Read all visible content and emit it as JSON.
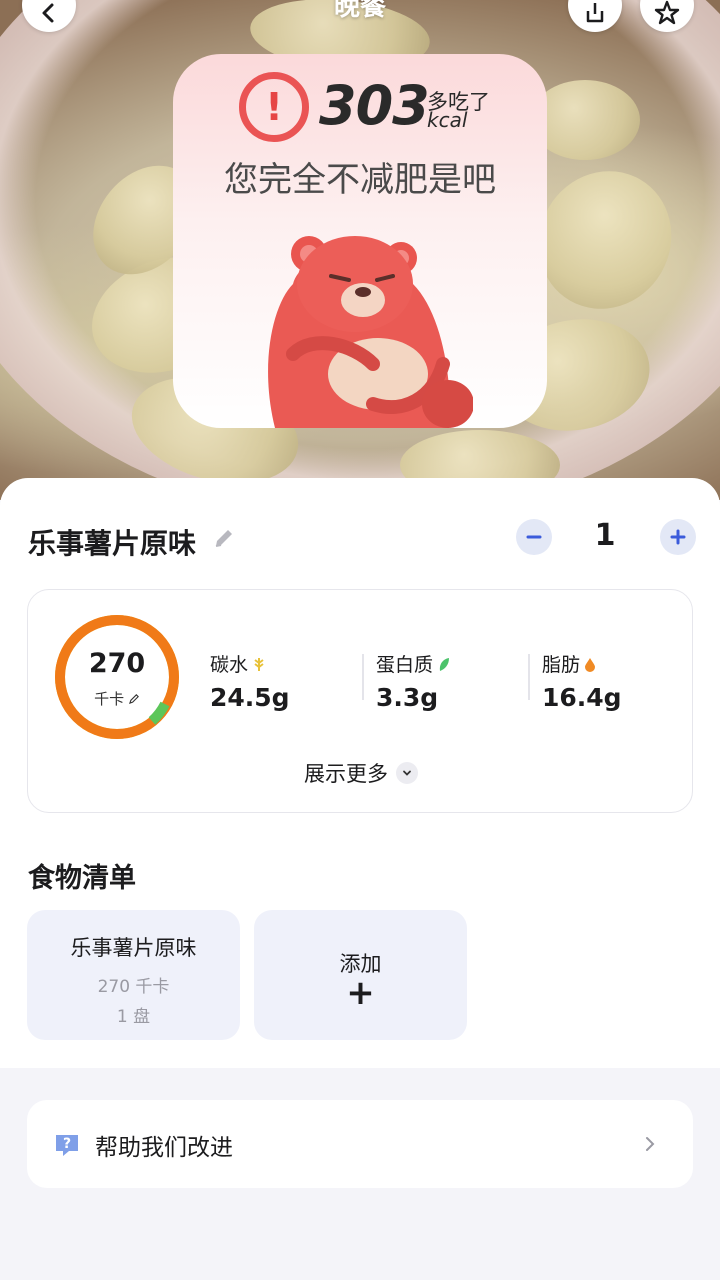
{
  "header": {
    "meal_title": "晚餐"
  },
  "warning": {
    "calories_over": "303",
    "over_label": "多吃了",
    "unit": "kcal",
    "message": "您完全不减肥是吧"
  },
  "food": {
    "name": "乐事薯片原味",
    "quantity": "1"
  },
  "nutrition": {
    "calories": "270",
    "calories_unit": "千卡",
    "macros": [
      {
        "label": "碳水",
        "value": "24.5g",
        "icon": "wheat-icon",
        "color": "#e8c23a"
      },
      {
        "label": "蛋白质",
        "value": "3.3g",
        "icon": "leaf-icon",
        "color": "#4cc36b"
      },
      {
        "label": "脂肪",
        "value": "16.4g",
        "icon": "drop-icon",
        "color": "#f08a24"
      }
    ],
    "show_more": "展示更多"
  },
  "food_list": {
    "title": "食物清单",
    "items": [
      {
        "name": "乐事薯片原味",
        "kcal": "270 千卡",
        "qty": "1 盘"
      }
    ],
    "add_label": "添加",
    "add_symbol": "+"
  },
  "help": {
    "label": "帮助我们改进"
  },
  "colors": {
    "accent": "#3b5bdb",
    "warning": "#ea5454",
    "ring_orange": "#f07a18",
    "ring_yellow": "#f3c41f",
    "ring_green": "#5cc65a"
  }
}
